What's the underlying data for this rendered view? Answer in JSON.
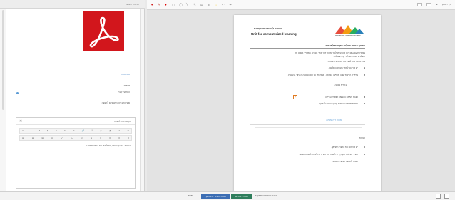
{
  "left_panel": {
    "title": "הוראות ההגשה",
    "folder_link": "הנחיות ▾",
    "section_title": "הגשה",
    "upload_label": "העלאת קובץ",
    "allowed_types": "סוגי הקבצים המותרים להגשה",
    "editor": {
      "label": "טקסט מקוון להגשה",
      "toolbar_row1": [
        "A",
        "I",
        "B",
        "¶",
        "≡",
        "≡",
        "⊞",
        "🔗",
        "⚿",
        "▶",
        "▣",
        "A",
        "↶"
      ],
      "toolbar_row2": [
        "⊞",
        "⊟",
        "⊞",
        "Ω",
        "✓",
        "x₂",
        "x¹",
        "S",
        "≡",
        "≡",
        "≡",
        "≡"
      ],
      "text": "הערות: הקובץ הועלה, נא לבדוק את הגשה מספר 2"
    }
  },
  "viewer": {
    "toolbar_icons": [
      "▾",
      "✎",
      "●",
      "▢",
      "◯",
      "╲",
      "✎",
      "▤",
      "▥",
      "⌂",
      "↶",
      "↷"
    ],
    "right_tools": [
      "דף ראשון",
      "⊕"
    ],
    "page": {
      "logo_text": "האוניברסיטה הפתוחה",
      "title_he": "היחידה להוראה מתוקשבת",
      "title_en": "Unit for computerized learning",
      "heading": "מדריך הגשת מטלות מקוונות למנחים",
      "intro_1": "במערכת Moodle ניתן להגיש מטלות ישירות דרך אתר הקורס. המדריך מפרט את",
      "intro_2": "השלבים הנדרשים לבדיקת המטלות:",
      "intro_3": "בכל מטלה ניתן לבצע את הפעולות הבאות:",
      "items": [
        {
          "num": "1",
          "text": "יש להיכנס לאתר הקורס הרלוונטי."
        },
        {
          "num": "2",
          "text": "ביחידת הלימוד שבה מופיעה המטלה, יש ללחוץ על שם המטלה ולבחור בהגשות."
        },
        {
          "num": "",
          "text": "בחירת מטלה."
        },
        {
          "num": "3",
          "text": "הצגת רשימת ההגשות לצפייה ובדיקה"
        },
        {
          "num": "4",
          "text": "בחירת סטודנט והורדת קובץ ההגשה לבדיקה."
        }
      ],
      "blue_caption": "מתוך: דף המטלה",
      "section2": "הערות:",
      "items2": [
        {
          "num": "5",
          "text": "יש להעלות את הקובץ המתוקן."
        },
        {
          "num": "6",
          "text": "לאחר העלאת הקובץ, יש לשמור את השינויים ולעבור להגשה הבאה."
        },
        {
          "num": "",
          "text": "לעבור להגשה הבאה ברשימה."
        }
      ]
    }
  },
  "bottom_bar": {
    "search": "חיפוש",
    "btn_blue": "שמירת השינויים והמשך",
    "btn_green": "שמירת שינויים",
    "status": "הצגת ההגשות 2 מתוך 6"
  },
  "colors": {
    "pdf_red": "#d2161c",
    "accent_blue": "#3c6eb4",
    "accent_green": "#2e7d5b",
    "highlight_orange": "#e07b22"
  }
}
